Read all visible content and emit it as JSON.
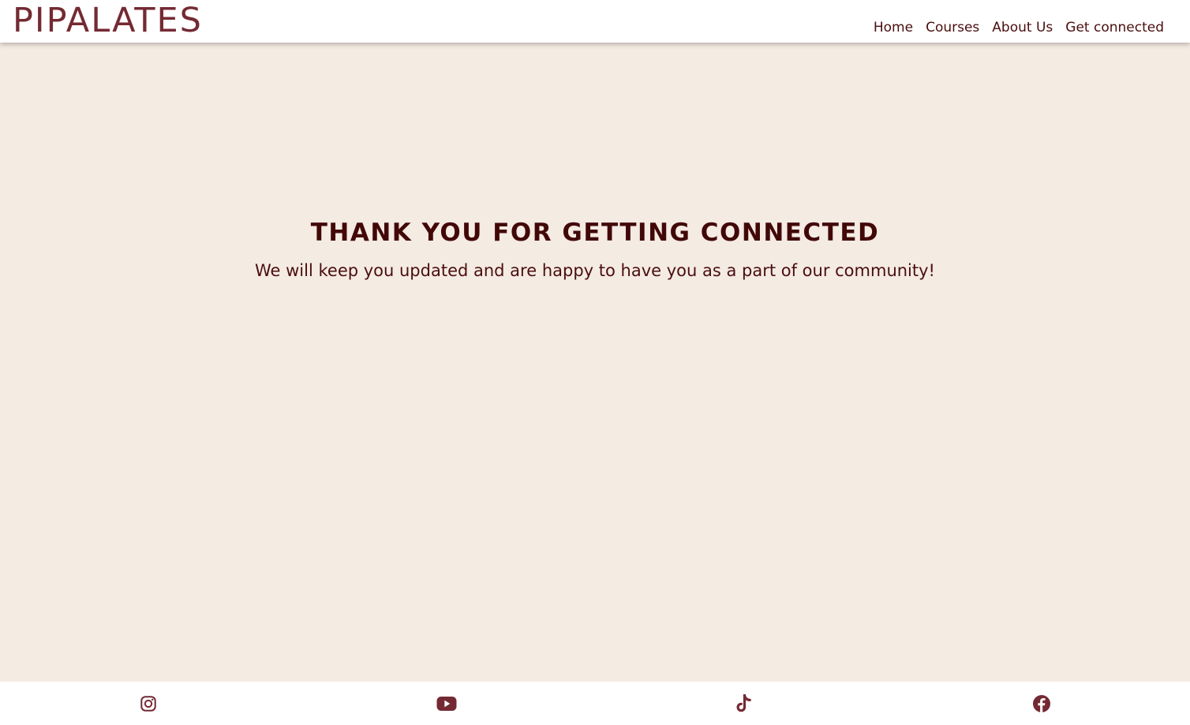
{
  "header": {
    "logo": "PIPALATES",
    "nav": [
      {
        "label": "Home"
      },
      {
        "label": "Courses"
      },
      {
        "label": "About Us"
      },
      {
        "label": "Get connected"
      }
    ]
  },
  "main": {
    "title": "THANK YOU FOR GETTING CONNECTED",
    "subtitle": "We will keep you updated and are happy to have you as a part of our community!"
  },
  "footer": {
    "social": [
      {
        "icon": "instagram-icon"
      },
      {
        "icon": "youtube-icon"
      },
      {
        "icon": "tiktok-icon"
      },
      {
        "icon": "facebook-icon"
      }
    ]
  },
  "colors": {
    "brand": "#742a33",
    "text_dark": "#420808",
    "background": "#f4ebe3",
    "header_bg": "#ffffff"
  }
}
